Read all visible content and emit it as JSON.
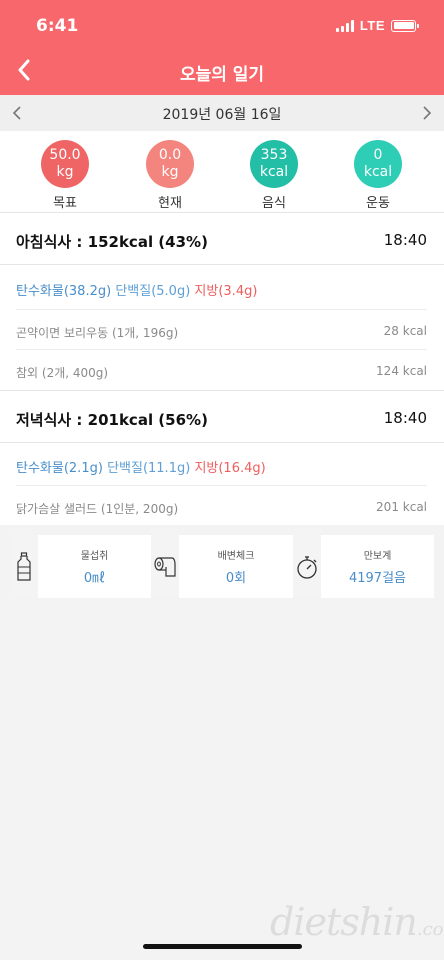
{
  "status": {
    "time": "6:41",
    "network": "LTE"
  },
  "header": {
    "title": "오늘의 일기"
  },
  "date": {
    "label": "2019년 06월 16일"
  },
  "stats": [
    {
      "value": "50.0",
      "unit": "kg",
      "label": "목표",
      "color": "#ef6565"
    },
    {
      "value": "0.0",
      "unit": "kg",
      "label": "현재",
      "color": "#f3857e"
    },
    {
      "value": "353",
      "unit": "kcal",
      "label": "음식",
      "color": "#22bfa6"
    },
    {
      "value": "0",
      "unit": "kcal",
      "label": "운동",
      "color": "#2ecdb5"
    }
  ],
  "meals": [
    {
      "title": "아침식사 : 152kcal (43%)",
      "time": "18:40",
      "carb": "탄수화물(38.2g)",
      "protein": "단백질(5.0g)",
      "fat": "지방(3.4g)",
      "foods": [
        {
          "name": "곤약이면 보리우동 (1개, 196g)",
          "kcal": "28 kcal"
        },
        {
          "name": "참외 (2개, 400g)",
          "kcal": "124 kcal"
        }
      ]
    },
    {
      "title": "저녁식사 : 201kcal (56%)",
      "time": "18:40",
      "carb": "탄수화물(2.1g)",
      "protein": "단백질(11.1g)",
      "fat": "지방(16.4g)",
      "foods": [
        {
          "name": "닭가슴살 샐러드 (1인분, 200g)",
          "kcal": "201 kcal"
        }
      ]
    }
  ],
  "tracker": [
    {
      "icon": "water-bottle-icon",
      "label": "물섭취",
      "value": "0㎖"
    },
    {
      "icon": "toilet-paper-icon",
      "label": "배변체크",
      "value": "0회"
    },
    {
      "icon": "stopwatch-icon",
      "label": "만보계",
      "value": "4197걸음"
    }
  ],
  "watermark": {
    "main": "dietshin",
    "suffix": ".com"
  },
  "colors": {
    "header": "#f7676b",
    "accent_blue": "#4a8ec9",
    "fat_red": "#ee5e5e"
  }
}
